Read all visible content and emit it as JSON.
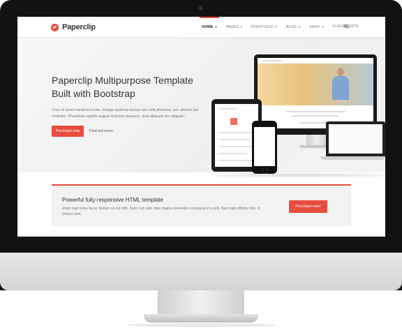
{
  "brand": {
    "name": "Paperclip"
  },
  "nav": {
    "items": [
      {
        "label": "Home",
        "active": true,
        "dropdown": true
      },
      {
        "label": "Pages",
        "dropdown": true
      },
      {
        "label": "Portfolio",
        "dropdown": true
      },
      {
        "label": "Blog",
        "dropdown": true
      },
      {
        "label": "Shop",
        "dropdown": true
      },
      {
        "label": "UI Elements",
        "dropdown": false
      }
    ],
    "caret": "▼"
  },
  "hero": {
    "title": "Paperclip Multipurpose Template Built with Bootstrap",
    "text": "Cras sit amet hendrerit tortor. Integer pulvinar lectus non velit pharetra, nec ultrices dui molestie. Phasellus sagittis augue id ipsum posuere, quis aliquam leo aliquam.",
    "primary_button": "Purchase now",
    "secondary_link": "Find out more"
  },
  "callout": {
    "title": "Powerful fully responsive HTML template",
    "text": "Etiam eget tellus lacus. Nullam eu est nibh. Nunc non odio vitae magna venenatis consequat ut a velit. Nam eget efficitur felis, in tempor sem.",
    "button": "Purchase now!"
  },
  "colors": {
    "accent": "#e84c3d",
    "monitor": "#121212"
  }
}
